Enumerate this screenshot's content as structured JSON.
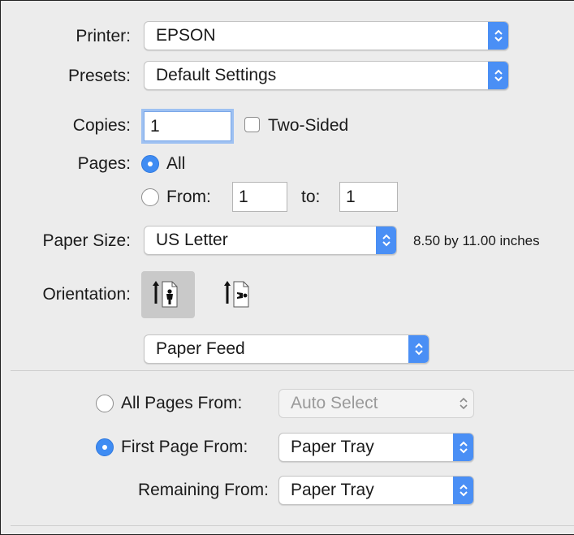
{
  "printer": {
    "label": "Printer:",
    "value": "EPSON"
  },
  "presets": {
    "label": "Presets:",
    "value": "Default Settings"
  },
  "copies": {
    "label": "Copies:",
    "value": "1",
    "two_sided_label": "Two-Sided",
    "two_sided_checked": false
  },
  "pages": {
    "label": "Pages:",
    "all_label": "All",
    "from_label": "From:",
    "from_value": "1",
    "to_label": "to:",
    "to_value": "1",
    "selected": "All"
  },
  "paper_size": {
    "label": "Paper Size:",
    "value": "US Letter",
    "dimensions": "8.50 by 11.00 inches"
  },
  "orientation": {
    "label": "Orientation:",
    "selected": "portrait",
    "options": [
      "portrait-icon",
      "landscape-icon"
    ]
  },
  "section_popup": {
    "value": "Paper Feed"
  },
  "paper_feed": {
    "all_pages_from_label": "All Pages From:",
    "all_pages_from_value": "Auto Select",
    "first_page_from_label": "First Page From:",
    "first_page_from_value": "Paper Tray",
    "remaining_from_label": "Remaining From:",
    "remaining_from_value": "Paper Tray",
    "selected": "First Page From"
  },
  "colors": {
    "accent": "#3f8cf3",
    "background": "#ececec"
  }
}
